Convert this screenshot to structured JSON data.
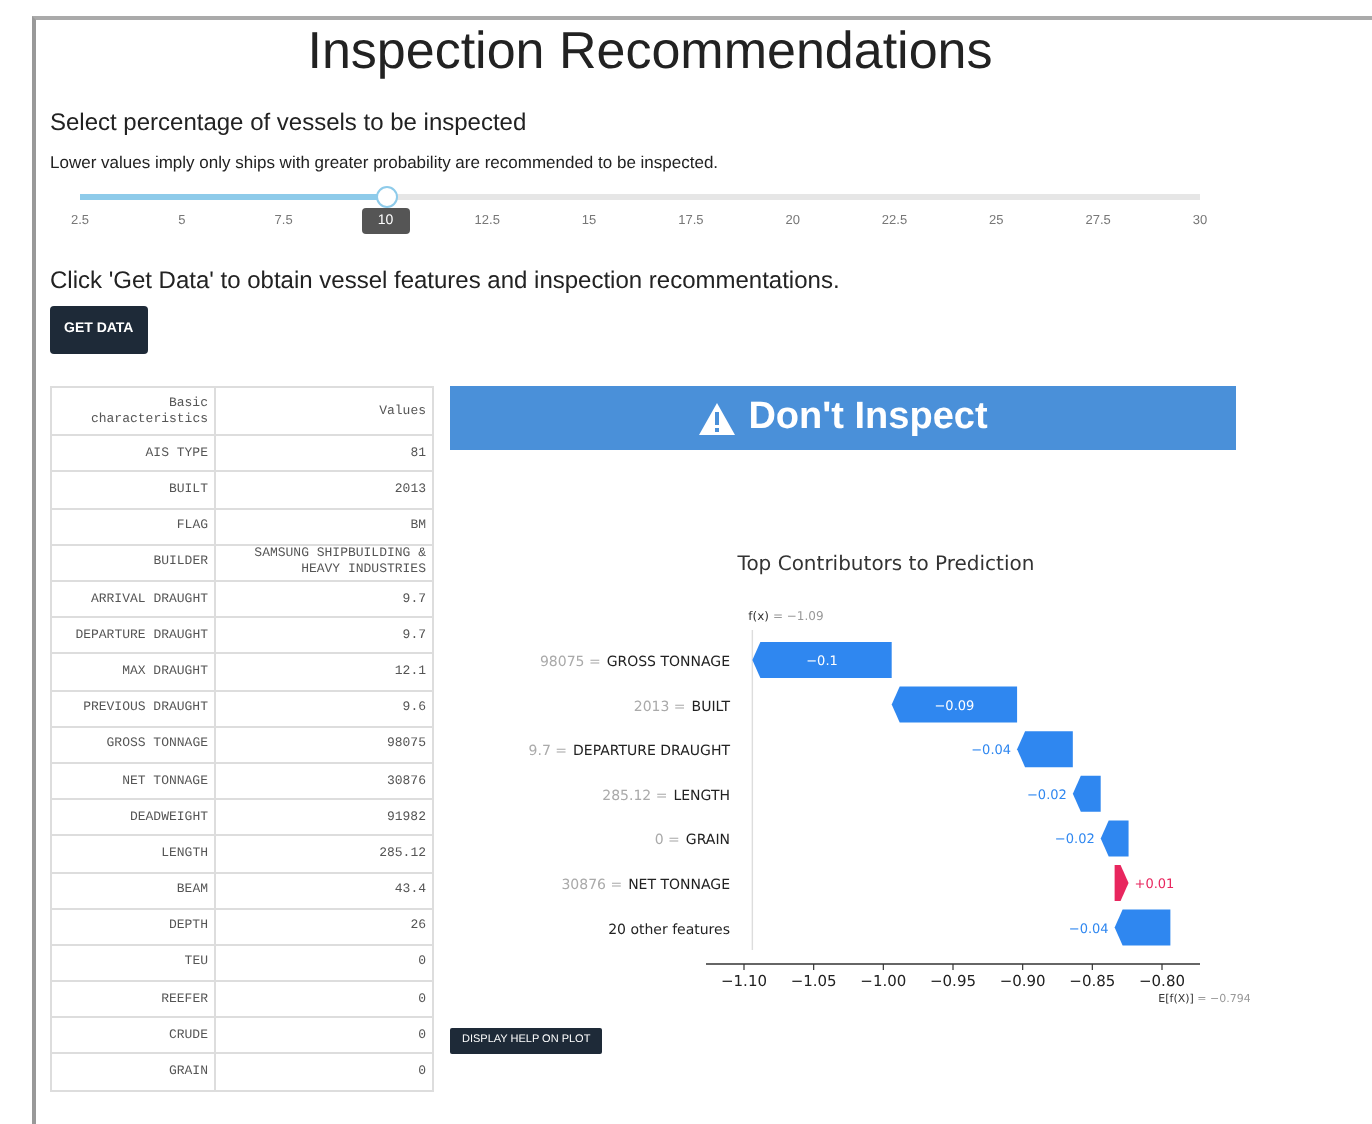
{
  "title": "Inspection Recommendations",
  "slider": {
    "label": "Select percentage of vessels to be inspected",
    "hint": "Lower values imply only ships with greater probability are recommended to be inspected.",
    "ticks": [
      {
        "label": "2.5",
        "selected": false
      },
      {
        "label": "5",
        "selected": false
      },
      {
        "label": "7.5",
        "selected": false
      },
      {
        "label": "10",
        "selected": true
      },
      {
        "label": "12.5",
        "selected": false
      },
      {
        "label": "15",
        "selected": false
      },
      {
        "label": "17.5",
        "selected": false
      },
      {
        "label": "20",
        "selected": false
      },
      {
        "label": "22.5",
        "selected": false
      },
      {
        "label": "25",
        "selected": false
      },
      {
        "label": "27.5",
        "selected": false
      },
      {
        "label": "30",
        "selected": false
      }
    ],
    "level": 0.2727
  },
  "instruction": "Click 'Get Data' to obtain vessel features and inspection recommentations.",
  "get_data_button": "GET DATA",
  "table": {
    "columns": [
      "Basic characteristics",
      "Values"
    ],
    "rows": [
      [
        "AIS TYPE",
        "81"
      ],
      [
        "BUILT",
        "2013"
      ],
      [
        "FLAG",
        "BM"
      ],
      [
        "BUILDER",
        "SAMSUNG SHIPBUILDING & HEAVY INDUSTRIES"
      ],
      [
        "ARRIVAL DRAUGHT",
        "9.7"
      ],
      [
        "DEPARTURE DRAUGHT",
        "9.7"
      ],
      [
        "MAX DRAUGHT",
        "12.1"
      ],
      [
        "PREVIOUS DRAUGHT",
        "9.6"
      ],
      [
        "GROSS TONNAGE",
        "98075"
      ],
      [
        "NET TONNAGE",
        "30876"
      ],
      [
        "DEADWEIGHT",
        "91982"
      ],
      [
        "LENGTH",
        "285.12"
      ],
      [
        "BEAM",
        "43.4"
      ],
      [
        "DEPTH",
        "26"
      ],
      [
        "TEU",
        "0"
      ],
      [
        "REEFER",
        "0"
      ],
      [
        "CRUDE",
        "0"
      ],
      [
        "GRAIN",
        "0"
      ]
    ]
  },
  "recommendation": {
    "text": "Don't Inspect",
    "color": "#4a90d9"
  },
  "waterfall": {
    "title": "Top Contributors to Prediction",
    "prediction": {
      "name": "f(x)",
      "text": "= −1.09"
    },
    "rows": [
      {
        "feature_value": "98075 =",
        "feature": "GROSS TONNAGE",
        "contribution": "−0.1"
      },
      {
        "feature_value": "2013 =",
        "feature": "BUILT",
        "contribution": "−0.09"
      },
      {
        "feature_value": "9.7 =",
        "feature": "DEPARTURE DRAUGHT",
        "contribution": "−0.04"
      },
      {
        "feature_value": "285.12 =",
        "feature": "LENGTH",
        "contribution": "−0.02"
      },
      {
        "feature_value": "0 =",
        "feature": "GRAIN",
        "contribution": "−0.02"
      },
      {
        "feature_value": "30876 =",
        "feature": "NET TONNAGE",
        "contribution": "+0.01"
      },
      {
        "feature": "20 other features",
        "contribution": "−0.04"
      }
    ],
    "x_ticks": [
      "−1.10",
      "−1.05",
      "−1.00",
      "−0.95",
      "−0.90",
      "−0.85",
      "−0.80"
    ],
    "expected": {
      "name": "E[f(X)]",
      "text": "= −0.794"
    }
  },
  "help_button": "DISPLAY HELP ON PLOT"
}
